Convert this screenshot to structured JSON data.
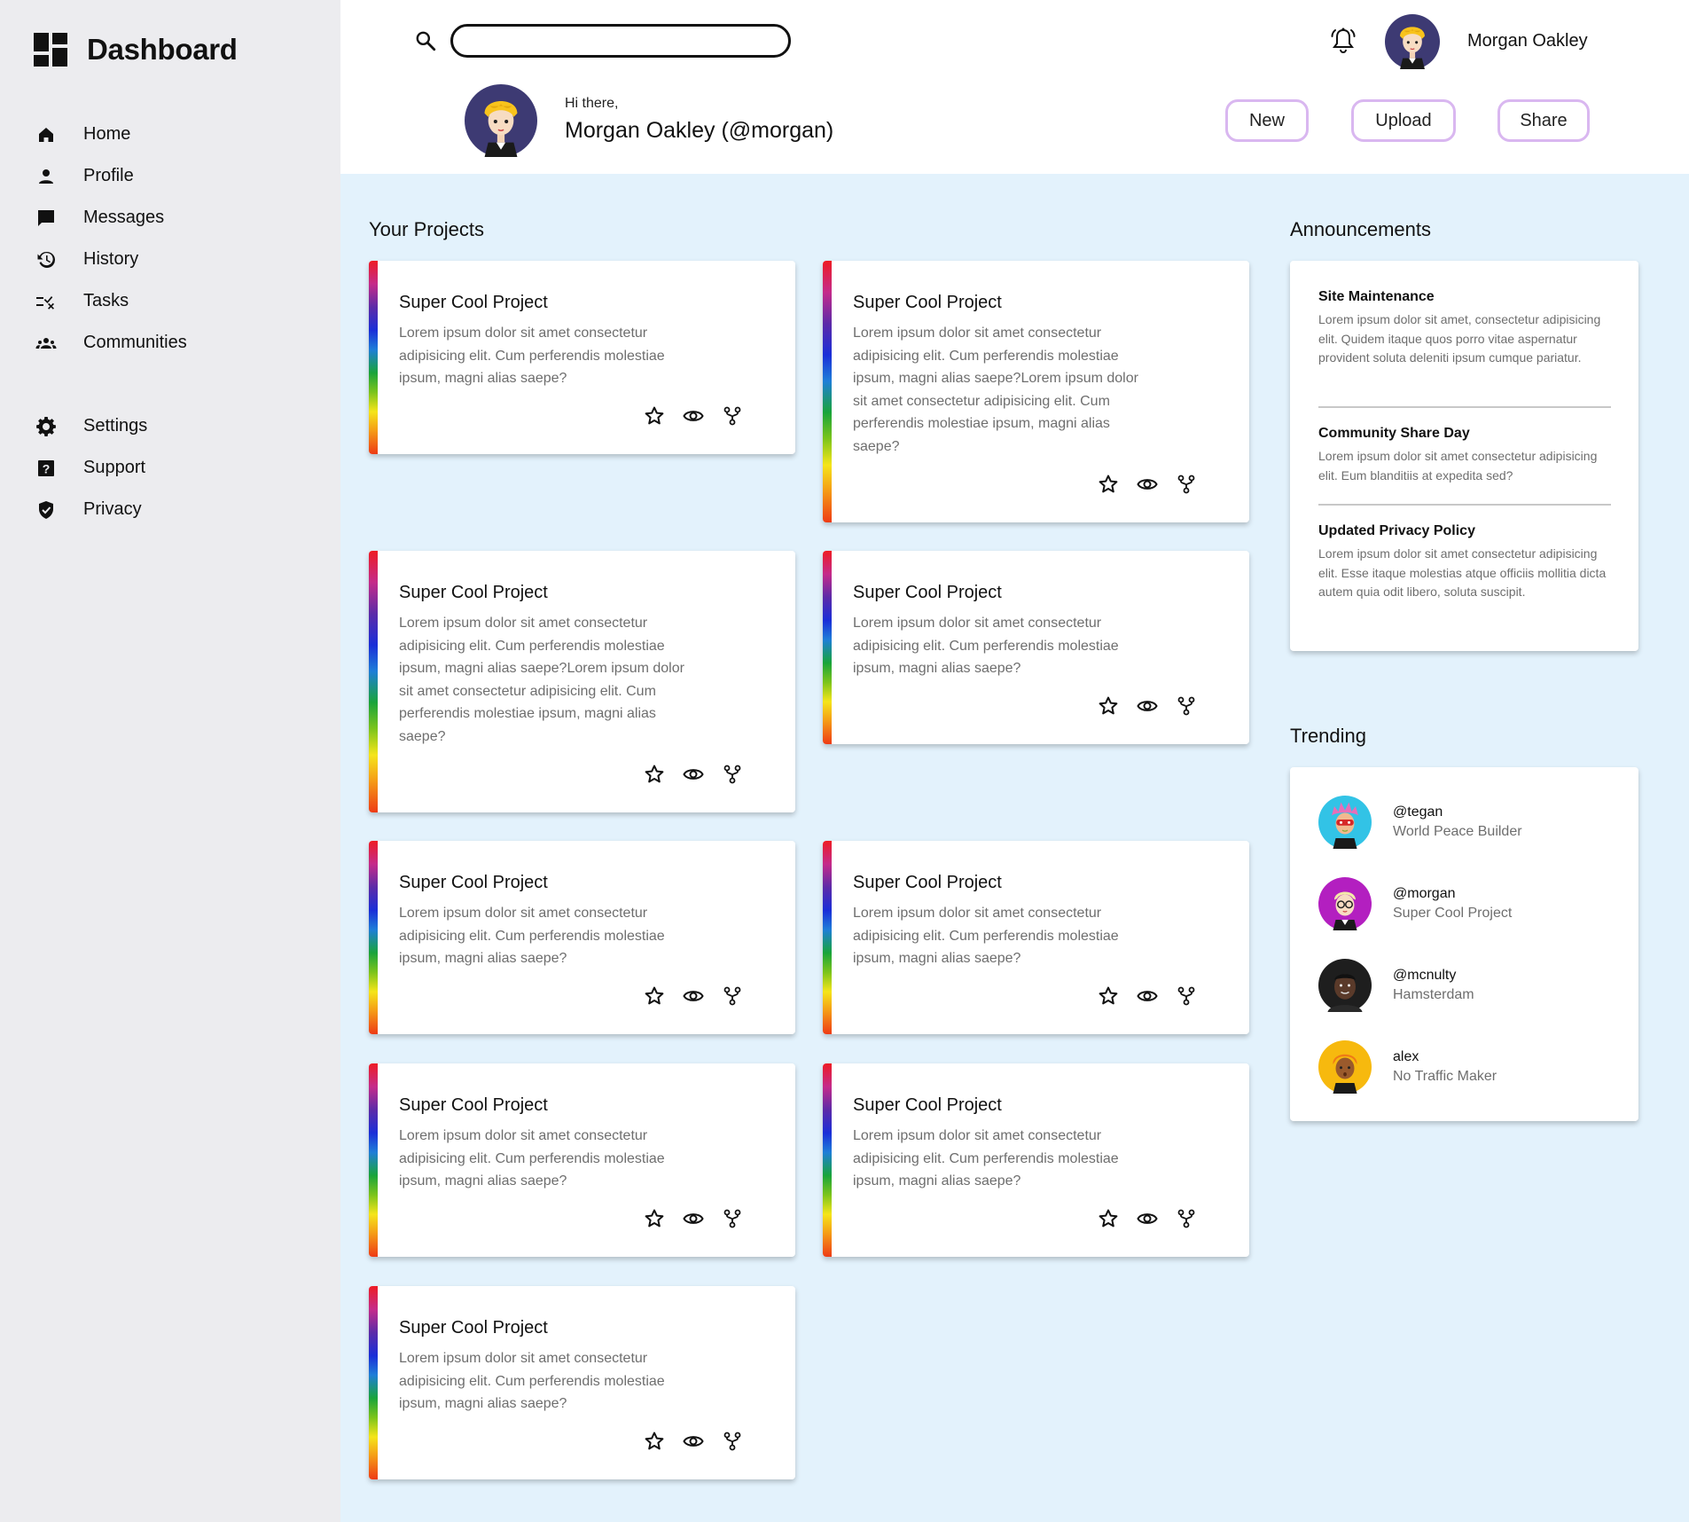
{
  "sidebar": {
    "title": "Dashboard",
    "nav": [
      {
        "label": "Home",
        "icon": "home-icon"
      },
      {
        "label": "Profile",
        "icon": "person-icon"
      },
      {
        "label": "Messages",
        "icon": "message-icon"
      },
      {
        "label": "History",
        "icon": "history-icon"
      },
      {
        "label": "Tasks",
        "icon": "tasks-icon"
      },
      {
        "label": "Communities",
        "icon": "communities-icon"
      }
    ],
    "nav_secondary": [
      {
        "label": "Settings",
        "icon": "gear-icon"
      },
      {
        "label": "Support",
        "icon": "help-icon"
      },
      {
        "label": "Privacy",
        "icon": "shield-icon"
      }
    ]
  },
  "header": {
    "search": {
      "value": "",
      "placeholder": ""
    },
    "user_name": "Morgan Oakley",
    "greeting": "Hi there,",
    "full_name": "Morgan Oakley (@morgan)",
    "buttons": {
      "new": "New",
      "upload": "Upload",
      "share": "Share"
    }
  },
  "projects": {
    "title": "Your Projects",
    "cards": [
      {
        "title": "Super Cool Project",
        "desc": "Lorem ipsum dolor sit amet consectetur adipisicing elit. Cum perferendis molestiae ipsum, magni alias saepe?"
      },
      {
        "title": "Super Cool Project",
        "desc": "Lorem ipsum dolor sit amet consectetur adipisicing elit. Cum perferendis molestiae ipsum, magni alias saepe?Lorem ipsum dolor sit amet consectetur adipisicing elit. Cum perferendis molestiae ipsum, magni alias saepe?"
      },
      {
        "title": "Super Cool Project",
        "desc": "Lorem ipsum dolor sit amet consectetur adipisicing elit. Cum perferendis molestiae ipsum, magni alias saepe?Lorem ipsum dolor sit amet consectetur adipisicing elit. Cum perferendis molestiae ipsum, magni alias saepe?"
      },
      {
        "title": "Super Cool Project",
        "desc": "Lorem ipsum dolor sit amet consectetur adipisicing elit. Cum perferendis molestiae ipsum, magni alias saepe?"
      },
      {
        "title": "Super Cool Project",
        "desc": "Lorem ipsum dolor sit amet consectetur adipisicing elit. Cum perferendis molestiae ipsum, magni alias saepe?"
      },
      {
        "title": "Super Cool Project",
        "desc": "Lorem ipsum dolor sit amet consectetur adipisicing elit. Cum perferendis molestiae ipsum, magni alias saepe?"
      },
      {
        "title": "Super Cool Project",
        "desc": "Lorem ipsum dolor sit amet consectetur adipisicing elit. Cum perferendis molestiae ipsum, magni alias saepe?"
      },
      {
        "title": "Super Cool Project",
        "desc": "Lorem ipsum dolor sit amet consectetur adipisicing elit. Cum perferendis molestiae ipsum, magni alias saepe?"
      },
      {
        "title": "Super Cool Project",
        "desc": "Lorem ipsum dolor sit amet consectetur adipisicing elit. Cum perferendis molestiae ipsum, magni alias saepe?"
      }
    ],
    "actions": [
      "star-icon",
      "eye-icon",
      "fork-icon"
    ]
  },
  "announcements": {
    "title": "Announcements",
    "items": [
      {
        "title": "Site Maintenance",
        "body": "Lorem ipsum dolor sit amet, consectetur adipisicing elit. Quidem itaque quos porro vitae aspernatur provident soluta deleniti ipsum cumque pariatur."
      },
      {
        "title": "Community Share Day",
        "body": "Lorem ipsum dolor sit amet consectetur adipisicing elit. Eum blanditiis at expedita sed?"
      },
      {
        "title": "Updated Privacy Policy",
        "body": "Lorem ipsum dolor sit amet consectetur adipisicing elit. Esse itaque molestias atque officiis mollitia dicta autem quia odit libero, soluta suscipit."
      }
    ]
  },
  "trending": {
    "title": "Trending",
    "items": [
      {
        "handle": "@tegan",
        "sub": "World Peace Builder"
      },
      {
        "handle": "@morgan",
        "sub": "Super Cool Project"
      },
      {
        "handle": "@mcnulty",
        "sub": "Hamsterdam"
      },
      {
        "handle": "alex",
        "sub": "No Traffic Maker"
      }
    ]
  },
  "colors": {
    "accent_border": "#d9b7f0",
    "main_bg": "#e3f2fc",
    "sidebar_bg": "#ececef"
  }
}
